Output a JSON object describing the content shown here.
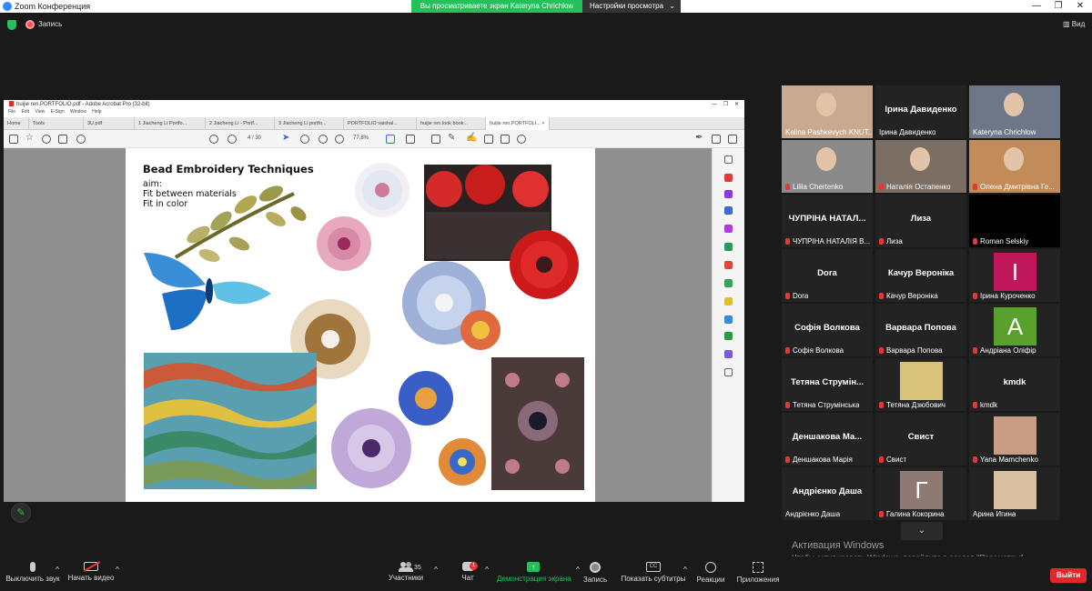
{
  "window": {
    "title": "Zoom Конференция",
    "share_banner": "Вы просматриваете экран Kateryna Chrichlow",
    "view_options": "Настройки просмотра",
    "minimize": "—",
    "maximize": "❐",
    "close": "✕"
  },
  "meeting_bar": {
    "recording_label": "Запись",
    "view_label": "Вид"
  },
  "acrobat": {
    "title": "huijie ren.PORTFOLIO.pdf - Adobe Acrobat Pro (32-bit)",
    "menu": [
      "File",
      "Edit",
      "View",
      "E-Sign",
      "Window",
      "Help"
    ],
    "tabs": [
      "Home",
      "Tools",
      "3U.pdf",
      "1 Jiacheng Li Portfo...",
      "2 Jiacheng Li - Portf...",
      "3 Jiacheng Li portfo...",
      "PORTFOLIO vaishal...",
      "huijie ren.look book...",
      "huijie ren.PORTFOLI..."
    ],
    "tab_close": "×",
    "page_current": "4",
    "page_total": "/ 30",
    "zoom": "77,8%"
  },
  "pdf": {
    "title": "Bead Embroidery Techniques",
    "line1": "aim:",
    "line2": "Fit between materials",
    "line3": "Fit in color"
  },
  "participants": [
    {
      "name": "Kalina Pashkevych KNUT...",
      "type": "video",
      "bg": "#c9a98f"
    },
    {
      "name": "Ірина Давиденко",
      "big": "Ірина Давиденко",
      "type": "name"
    },
    {
      "name": "Kateryna Chrichlow",
      "type": "video",
      "bg": "#6e7788",
      "active": true
    },
    {
      "name": "Liliia Chertenko",
      "type": "video",
      "bg": "#8a8a8a",
      "muted": true
    },
    {
      "name": "Наталія Остапенко",
      "type": "video",
      "bg": "#7d6e63",
      "muted": true
    },
    {
      "name": "Олена Дмитрівна Ге...",
      "type": "video",
      "bg": "#c28b5a",
      "muted": true
    },
    {
      "name": "ЧУПРІНА НАТАЛІЯ В...",
      "big": "ЧУПРІНА НАТАЛ...",
      "type": "name",
      "muted": true
    },
    {
      "name": "Лиза",
      "big": "Лиза",
      "type": "name",
      "muted": true
    },
    {
      "name": "Roman Selskiy",
      "type": "blank",
      "muted": true
    },
    {
      "name": "Dora",
      "big": "Dora",
      "type": "name",
      "muted": true
    },
    {
      "name": "Качур Вероніка",
      "big": "Качур Вероніка",
      "type": "name",
      "muted": true
    },
    {
      "name": "Ірина Куроченко",
      "type": "letter",
      "letter": "I",
      "bg": "#c0185a",
      "muted": true
    },
    {
      "name": "Софія Волкова",
      "big": "Софія Волкова",
      "type": "name",
      "muted": true
    },
    {
      "name": "Варвара Попова",
      "big": "Варвара Попова",
      "type": "name",
      "muted": true
    },
    {
      "name": "Андріана Оліфір",
      "type": "letter",
      "letter": "А",
      "bg": "#5aa02c",
      "muted": true
    },
    {
      "name": "Тетяна Струмінська",
      "big": "Тетяна Струмін...",
      "type": "name",
      "muted": true
    },
    {
      "name": "Тетяна Дзюбович",
      "type": "photo",
      "bg": "#d9c27a",
      "muted": true
    },
    {
      "name": "kmdk",
      "big": "kmdk",
      "type": "name",
      "muted": true
    },
    {
      "name": "Деншакова Марія",
      "big": "Деншакова Ма...",
      "type": "name",
      "muted": true
    },
    {
      "name": "Свист",
      "big": "Свист",
      "type": "name",
      "muted": true
    },
    {
      "name": "Yana Mamchenko",
      "type": "photo",
      "bg": "#c99c84",
      "muted": true
    },
    {
      "name": "Андрієнко Даша",
      "big": "Андрієнко Даша",
      "type": "name"
    },
    {
      "name": "Галина Кокорина",
      "type": "letter",
      "letter": "Г",
      "bg": "#8e7a72",
      "muted": true
    },
    {
      "name": "Арина Игина",
      "type": "photo",
      "bg": "#d8c0a0"
    }
  ],
  "toolbar": {
    "mute": "Выключить звук",
    "video": "Начать видео",
    "participants": "Участники",
    "participants_count": "35",
    "chat": "Чат",
    "chat_badge": "1",
    "share": "Демонстрация экрана",
    "record": "Запись",
    "captions": "Показать субтитры",
    "reactions": "Реакции",
    "apps": "Приложения",
    "end": "Выйти"
  },
  "windows_watermark": {
    "title": "Активация Windows",
    "sub": "Чтобы активировать Windows, перейдите в раздел \"Параметры\"."
  },
  "colors": {
    "zoom_blue": "#2d8cff",
    "share_green": "#23c15a",
    "end_red": "#e02828",
    "active_speaker": "#c7e34a"
  }
}
